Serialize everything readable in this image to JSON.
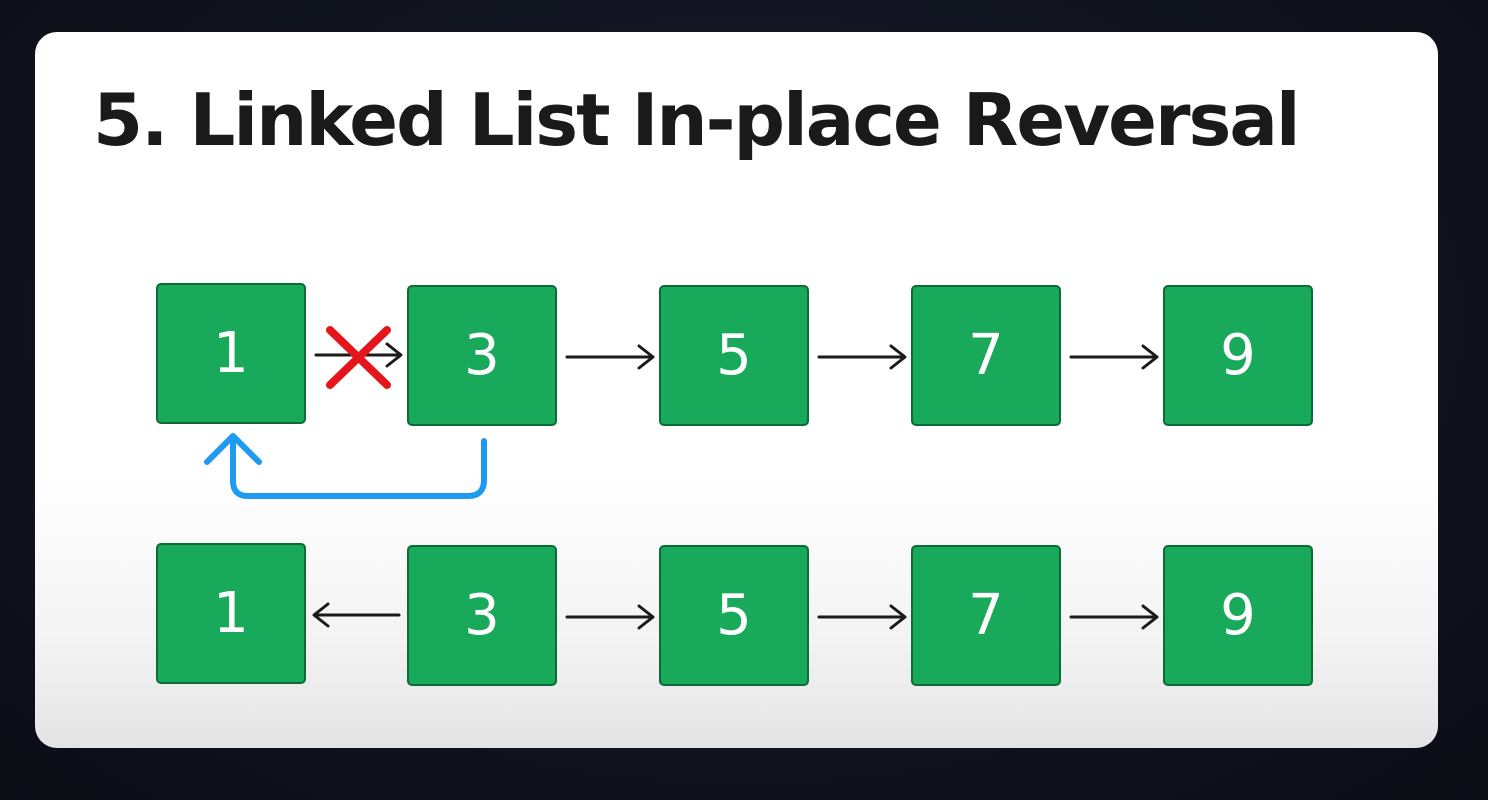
{
  "title": "5. Linked List In-place Reversal",
  "rows": [
    {
      "nodes": [
        "1",
        "3",
        "5",
        "7",
        "9"
      ]
    },
    {
      "nodes": [
        "1",
        "3",
        "5",
        "7",
        "9"
      ]
    }
  ],
  "colors": {
    "node_fill": "#19a95a",
    "node_border": "#0d6b38",
    "pointer_arrow": "#1a1a1a",
    "removed_link": "#e5161b",
    "new_link": "#1e9bf0"
  }
}
